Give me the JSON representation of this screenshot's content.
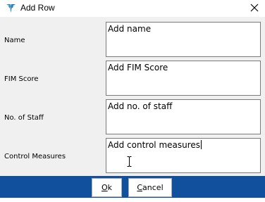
{
  "window": {
    "title": "Add Row",
    "icon": "funnel-logo-icon",
    "close_icon": "close-icon"
  },
  "fields": [
    {
      "label": "Name",
      "value": "Add name"
    },
    {
      "label": "FIM Score",
      "value": "Add FIM Score"
    },
    {
      "label": "No. of Staff",
      "value": "Add no. of staff"
    },
    {
      "label": "Control Measures",
      "value": "Add control measures"
    }
  ],
  "buttons": {
    "ok": {
      "mnemonic": "O",
      "rest": "k"
    },
    "cancel": {
      "mnemonic": "C",
      "rest": "ancel"
    }
  },
  "colors": {
    "footer": "#11509c",
    "content_bg": "#f0f0f0"
  }
}
